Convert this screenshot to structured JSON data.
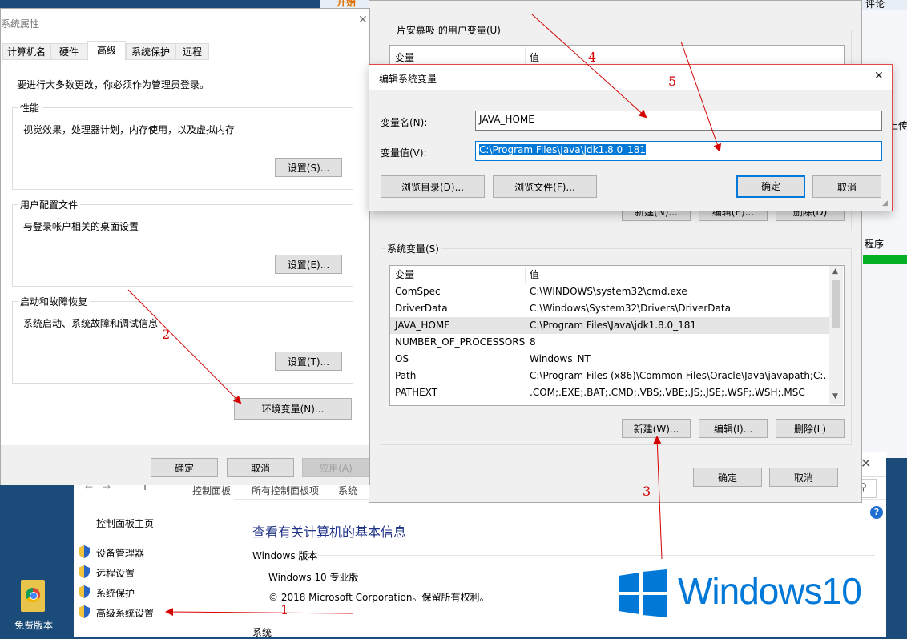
{
  "top_strip": {
    "orange_text": "开始",
    "right_text": "评论"
  },
  "sysprop": {
    "title": "系统属性",
    "tabs": [
      "计算机名",
      "硬件",
      "高级",
      "系统保护",
      "远程"
    ],
    "admin_note": "要进行大多数更改，你必须作为管理员登录。",
    "performance": {
      "title": "性能",
      "desc": "视觉效果，处理器计划，内存使用，以及虚拟内存",
      "btn": "设置(S)..."
    },
    "profile": {
      "title": "用户配置文件",
      "desc": "与登录帐户相关的桌面设置",
      "btn": "设置(E)..."
    },
    "startup": {
      "title": "启动和故障恢复",
      "desc": "系统启动、系统故障和调试信息",
      "btn": "设置(T)..."
    },
    "env_btn": "环境变量(N)...",
    "ok": "确定",
    "cancel": "取消",
    "apply": "应用(A)"
  },
  "envvars": {
    "user_group": "一片安慕吸 的用户变量(U)",
    "col_var": "变量",
    "col_val": "值",
    "user_btns": [
      "新建(N)...",
      "编辑(E)...",
      "删除(D)"
    ],
    "sys_group": "系统变量(S)",
    "sys_rows": [
      {
        "name": "ComSpec",
        "value": "C:\\WINDOWS\\system32\\cmd.exe"
      },
      {
        "name": "DriverData",
        "value": "C:\\Windows\\System32\\Drivers\\DriverData"
      },
      {
        "name": "JAVA_HOME",
        "value": "C:\\Program Files\\Java\\jdk1.8.0_181"
      },
      {
        "name": "NUMBER_OF_PROCESSORS",
        "value": "8"
      },
      {
        "name": "OS",
        "value": "Windows_NT"
      },
      {
        "name": "Path",
        "value": "C:\\Program Files (x86)\\Common Files\\Oracle\\Java\\javapath;C:..."
      },
      {
        "name": "PATHEXT",
        "value": ".COM;.EXE;.BAT;.CMD;.VBS;.VBE;.JS;.JSE;.WSF;.WSH;.MSC"
      }
    ],
    "new_btn": "新建(W)...",
    "edit_btn": "编辑(I)...",
    "del_btn": "删除(L)",
    "ok": "确定",
    "cancel": "取消"
  },
  "editdlg": {
    "title": "编辑系统变量",
    "name_label": "变量名(N):",
    "name_value": "JAVA_HOME",
    "value_label": "变量值(V):",
    "value_value": "C:\\Program Files\\Java\\jdk1.8.0_181",
    "browse_dir": "浏览目录(D)...",
    "browse_file": "浏览文件(F)...",
    "ok": "确定",
    "cancel": "取消"
  },
  "control_panel": {
    "breadcrumb": [
      "控制面板",
      "所有控制面板项",
      "系统"
    ],
    "home_link": "控制面板主页",
    "links": [
      "设备管理器",
      "远程设置",
      "系统保护",
      "高级系统设置"
    ],
    "heading": "查看有关计算机的基本信息",
    "edition_section": "Windows 版本",
    "edition": "Windows 10 专业版",
    "copyright": "© 2018 Microsoft Corporation。保留所有权利。",
    "system_section": "系统",
    "logo_text": "Windows10"
  },
  "right_panel": {
    "text1": "上传",
    "text2": "程序"
  },
  "desktop": {
    "icon_label": "免费版本"
  },
  "annotations": [
    "1",
    "2",
    "3",
    "4",
    "5"
  ],
  "colors": {
    "accent": "#0078d7",
    "annotation": "#d40000",
    "selection": "#0078d7",
    "win_logo": "#0078d7"
  }
}
